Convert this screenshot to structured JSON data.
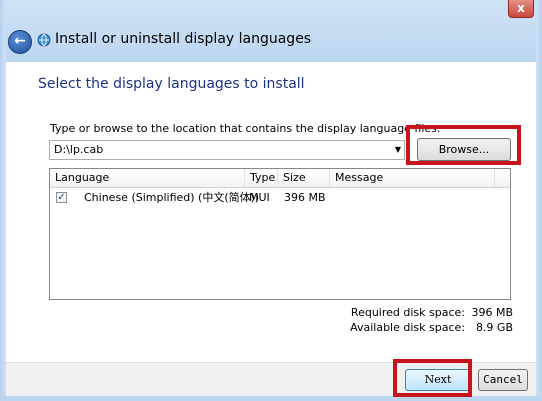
{
  "window": {
    "title": "Install or uninstall display languages",
    "close_label": "x",
    "back_label": "←"
  },
  "page": {
    "heading": "Select the display languages to install",
    "instruction": "Type or browse to the location that contains the display language files:",
    "path_value": "D:\\lp.cab",
    "browse_label": "Browse..."
  },
  "table": {
    "columns": [
      "Language",
      "Type",
      "Size",
      "Message"
    ],
    "rows": [
      {
        "checked": true,
        "language": "Chinese (Simplified) (中文(简体))",
        "type": "MUI",
        "size": "396 MB",
        "message": ""
      }
    ]
  },
  "disk": {
    "required_label": "Required disk space:",
    "required_value": "396 MB",
    "available_label": "Available disk space:",
    "available_value": "8.9 GB"
  },
  "footer": {
    "next_label": "Next",
    "cancel_label": "Cancel"
  },
  "colors": {
    "highlight": "#c8151d",
    "heading": "#1e3287"
  }
}
